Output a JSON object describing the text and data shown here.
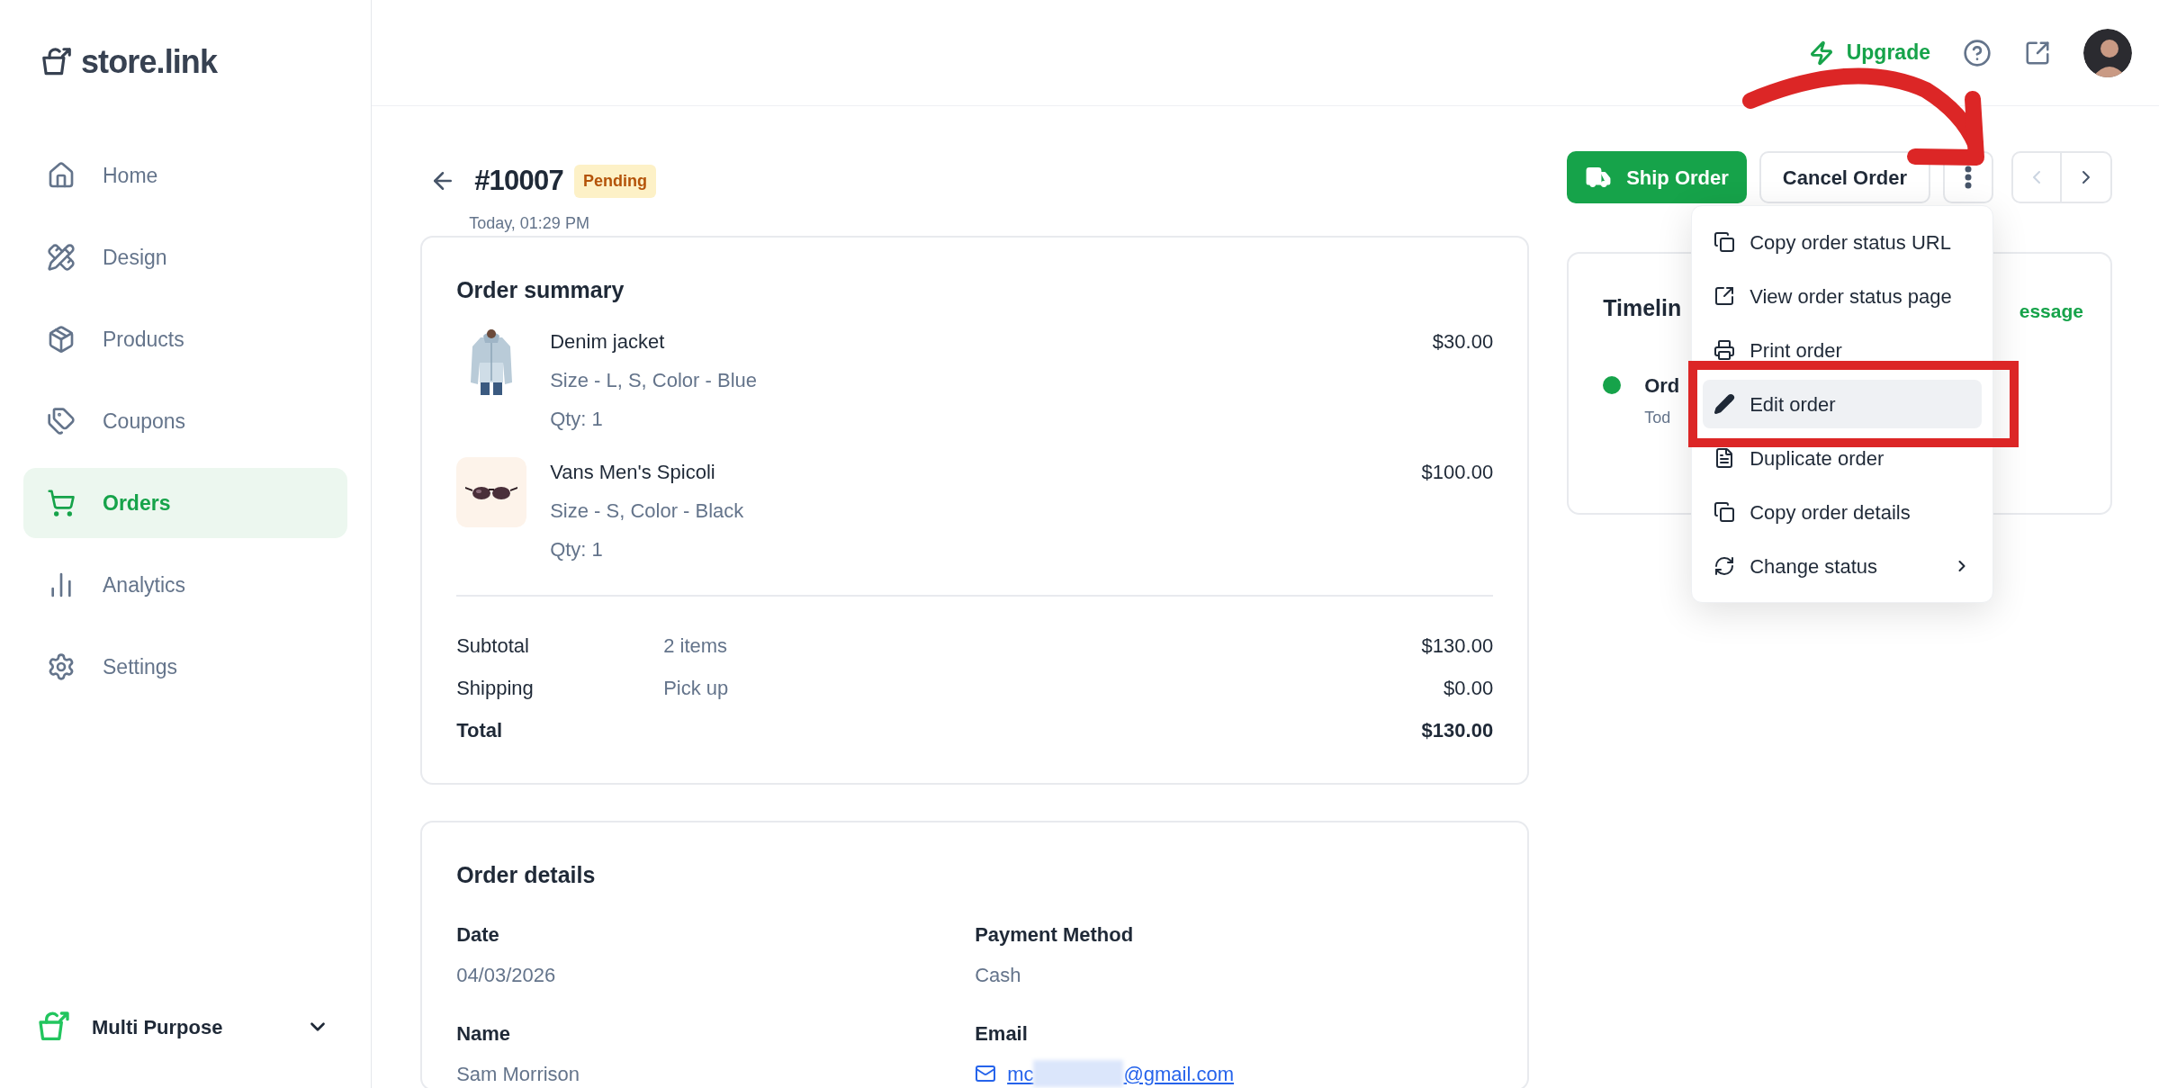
{
  "brand": {
    "name": "store.link"
  },
  "sidebar": {
    "items": [
      {
        "label": "Home",
        "selected": false
      },
      {
        "label": "Design",
        "selected": false
      },
      {
        "label": "Products",
        "selected": false
      },
      {
        "label": "Coupons",
        "selected": false
      },
      {
        "label": "Orders",
        "selected": true
      },
      {
        "label": "Analytics",
        "selected": false
      },
      {
        "label": "Settings",
        "selected": false
      }
    ],
    "store_switcher": {
      "label": "Multi Purpose"
    }
  },
  "header": {
    "upgrade": "Upgrade"
  },
  "order": {
    "number": "#10007",
    "status": "Pending",
    "time": "Today, 01:29 PM",
    "actions": {
      "ship": "Ship Order",
      "cancel": "Cancel Order"
    }
  },
  "menu": {
    "items": [
      {
        "label": "Copy order status URL",
        "selected": false,
        "submenu": false
      },
      {
        "label": "View order status page",
        "selected": false,
        "submenu": false
      },
      {
        "label": "Print order",
        "selected": false,
        "submenu": false
      },
      {
        "label": "Edit order",
        "selected": true,
        "submenu": false
      },
      {
        "label": "Duplicate order",
        "selected": false,
        "submenu": false
      },
      {
        "label": "Copy order details",
        "selected": false,
        "submenu": false
      },
      {
        "label": "Change status",
        "selected": false,
        "submenu": true
      }
    ]
  },
  "summary": {
    "title": "Order summary",
    "items": [
      {
        "kind": "picture",
        "name": "Denim jacket",
        "variant": "Size - L, S, Color - Blue",
        "qty": "Qty: 1",
        "price": "$30.00"
      },
      {
        "kind": "picture",
        "name": "Vans Men's Spicoli",
        "variant": "Size - S, Color - Black",
        "qty": "Qty: 1",
        "price": "$100.00"
      }
    ],
    "totals": [
      {
        "label": "Subtotal",
        "detail": "2 items",
        "amount": "$130.00",
        "bold": false
      },
      {
        "label": "Shipping",
        "detail": "Pick up",
        "amount": "$0.00",
        "bold": false
      },
      {
        "label": "Total",
        "amount": "$130.00",
        "bold": true
      }
    ]
  },
  "timeline": {
    "title": "Timelin",
    "link": "essage",
    "event": "Ord",
    "event_time": "Tod"
  },
  "details": {
    "title": "Order details",
    "fields": [
      {
        "label": "Date",
        "value": "04/03/2026"
      },
      {
        "label": "Payment Method",
        "value": "Cash"
      },
      {
        "label": "Name",
        "value": "Sam Morrison"
      },
      {
        "label": "Email",
        "value_start": "mc",
        "value_end": "@gmail.com",
        "kind": "email"
      }
    ]
  }
}
